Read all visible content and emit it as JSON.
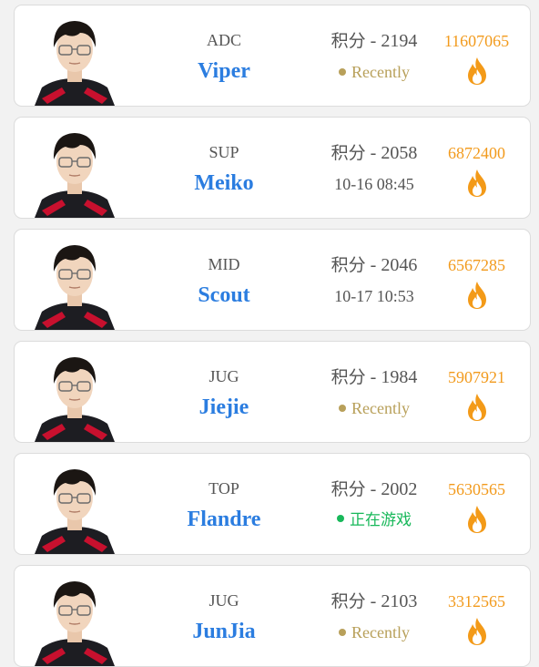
{
  "players": [
    {
      "role": "ADC",
      "name": "Viper",
      "score_label": "积分",
      "score_value": "2194",
      "status_type": "recent",
      "status_text": "Recently",
      "heat": "11607065",
      "avatar_icon": "player-portrait-icon",
      "fire_icon": "flame-icon"
    },
    {
      "role": "SUP",
      "name": "Meiko",
      "score_label": "积分",
      "score_value": "2058",
      "status_type": "time",
      "status_text": "10-16 08:45",
      "heat": "6872400",
      "avatar_icon": "player-portrait-icon",
      "fire_icon": "flame-icon"
    },
    {
      "role": "MID",
      "name": "Scout",
      "score_label": "积分",
      "score_value": "2046",
      "status_type": "time",
      "status_text": "10-17 10:53",
      "heat": "6567285",
      "avatar_icon": "player-portrait-icon",
      "fire_icon": "flame-icon"
    },
    {
      "role": "JUG",
      "name": "Jiejie",
      "score_label": "积分",
      "score_value": "1984",
      "status_type": "recent",
      "status_text": "Recently",
      "heat": "5907921",
      "avatar_icon": "player-portrait-icon",
      "fire_icon": "flame-icon"
    },
    {
      "role": "TOP",
      "name": "Flandre",
      "score_label": "积分",
      "score_value": "2002",
      "status_type": "ingame",
      "status_text": "正在游戏",
      "heat": "5630565",
      "avatar_icon": "player-portrait-icon",
      "fire_icon": "flame-icon"
    },
    {
      "role": "JUG",
      "name": "JunJia",
      "score_label": "积分",
      "score_value": "2103",
      "status_type": "recent",
      "status_text": "Recently",
      "heat": "3312565",
      "avatar_icon": "player-portrait-icon",
      "fire_icon": "flame-icon"
    }
  ],
  "colors": {
    "name_blue": "#2b7de0",
    "heat_orange": "#f29a1c",
    "recent_gold": "#b8a05a",
    "ingame_green": "#18b85a",
    "fire_orange": "#f39a18"
  }
}
